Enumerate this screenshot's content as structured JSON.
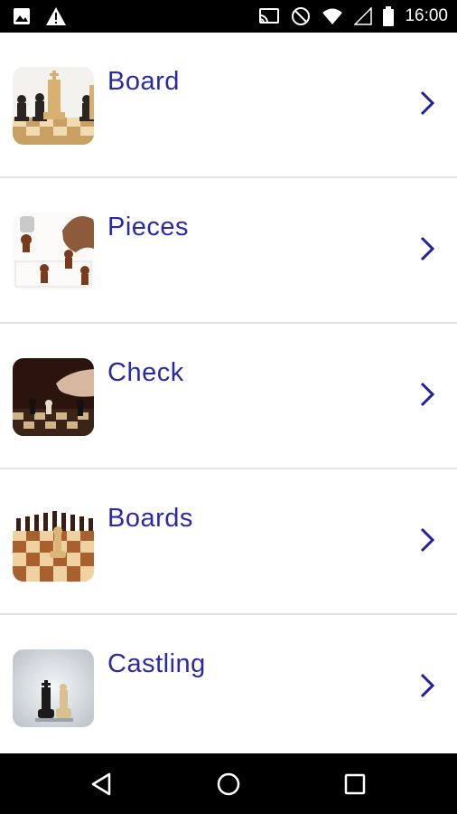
{
  "status_bar": {
    "time": "16:00",
    "left_icons": [
      "image-icon",
      "warning-icon"
    ],
    "right_icons": [
      "cast-icon",
      "do-not-disturb-icon",
      "wifi-icon",
      "signal-icon",
      "battery-icon"
    ]
  },
  "menu": {
    "items": [
      {
        "label": "Board",
        "thumbnail": "chess-pieces-on-board"
      },
      {
        "label": "Pieces",
        "thumbnail": "hand-moving-pieces"
      },
      {
        "label": "Check",
        "thumbnail": "hand-on-chessboard"
      },
      {
        "label": "Boards",
        "thumbnail": "wooden-chessboard"
      },
      {
        "label": "Castling",
        "thumbnail": "king-and-queen"
      }
    ],
    "label_color": "#2b2aa6",
    "chevron_color": "#1f1fa0"
  },
  "nav_bar": {
    "buttons": [
      "back-icon",
      "home-icon",
      "recents-icon"
    ]
  }
}
